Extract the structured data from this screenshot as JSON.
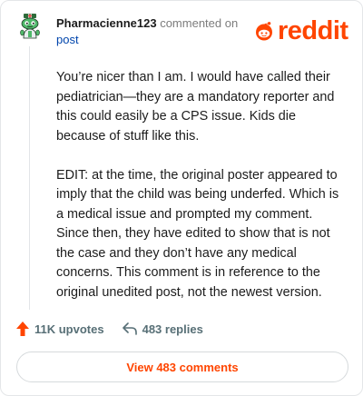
{
  "comment": {
    "username": "Pharmacienne123",
    "action_text": "commented on",
    "link_text": "post",
    "paragraphs": [
      "You’re nicer than I am. I would have called their pediatrician—they are a mandatory reporter and this could easily be a CPS issue. Kids die because of stuff like this.",
      "EDIT: at the time, the original poster appeared to imply that the child was being underfed. Which is a medical issue and prompted my comment. Since then, they have edited to show that is not the case and they don’t have any medical concerns. This comment is in reference to the original unedited post, not the newest version."
    ]
  },
  "brand": {
    "wordmark": "reddit",
    "color": "#ff4500"
  },
  "actions": {
    "upvotes": "11K upvotes",
    "replies": "483 replies"
  },
  "view_button": {
    "label": "View 483 comments"
  }
}
